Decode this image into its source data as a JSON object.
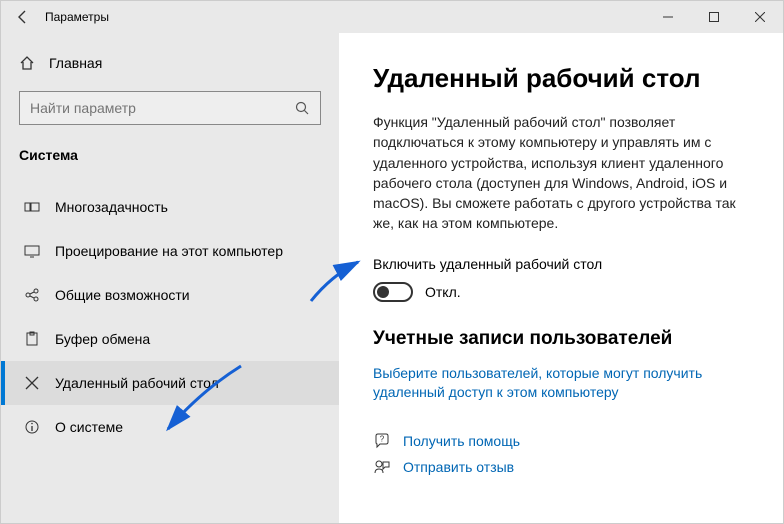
{
  "window": {
    "title": "Параметры"
  },
  "sidebar": {
    "home": "Главная",
    "search_placeholder": "Найти параметр",
    "category": "Система",
    "items": [
      {
        "label": "Многозадачность"
      },
      {
        "label": "Проецирование на этот компьютер"
      },
      {
        "label": "Общие возможности"
      },
      {
        "label": "Буфер обмена"
      },
      {
        "label": "Удаленный рабочий стол"
      },
      {
        "label": "О системе"
      }
    ]
  },
  "content": {
    "heading": "Удаленный рабочий стол",
    "description": "Функция \"Удаленный рабочий стол\" позволяет подключаться к этому компьютеру и управлять им с удаленного устройства, используя клиент удаленного рабочего стола (доступен для Windows, Android, iOS и macOS). Вы сможете работать с другого устройства так же, как на этом компьютере.",
    "toggle_label": "Включить удаленный рабочий стол",
    "toggle_state": "Откл.",
    "section2": "Учетные записи пользователей",
    "users_link": "Выберите пользователей, которые могут получить удаленный доступ к этом компьютеру",
    "help": "Получить помощь",
    "feedback": "Отправить отзыв"
  }
}
